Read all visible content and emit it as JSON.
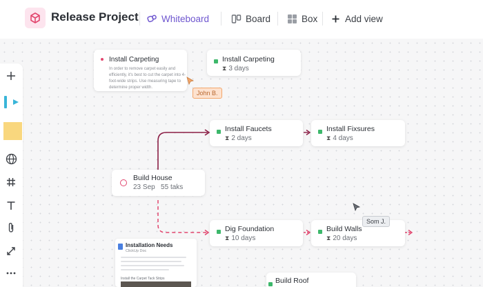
{
  "header": {
    "project_title": "Release Project",
    "tabs": [
      {
        "label": "Whiteboard",
        "icon": "whiteboard-icon",
        "active": true
      },
      {
        "label": "Board",
        "icon": "board-icon",
        "active": false
      },
      {
        "label": "Box",
        "icon": "box-icon",
        "active": false
      }
    ],
    "add_view_label": "Add view"
  },
  "toolbar": {
    "tools": [
      "plus-icon",
      "pen-icon",
      "sticky-note-icon",
      "globe-icon",
      "hash-icon",
      "text-icon",
      "attachment-icon",
      "connector-icon",
      "more-icon"
    ]
  },
  "note": {
    "title": "Install Carpeting",
    "body": "In order to remove carpet easily and efficiently, it's best to cut the carpet into 4-foot-wide strips. Use measuring tape to determine proper width."
  },
  "tasks": {
    "install_carpeting": {
      "name": "Install Carpeting",
      "duration": "3 days"
    },
    "install_faucets": {
      "name": "Install Faucets",
      "duration": "2 days"
    },
    "install_fixtures": {
      "name": "Install Fixsures",
      "duration": "4 days"
    },
    "dig_foundation": {
      "name": "Dig Foundation",
      "duration": "10 days"
    },
    "build_walls": {
      "name": "Build Walls",
      "duration": "20 days"
    },
    "build_roof": {
      "name": "Build Roof"
    }
  },
  "build_house": {
    "name": "Build House",
    "date": "23 Sep",
    "tasks": "55 taks"
  },
  "cursors": {
    "john": "John B.",
    "som": "Som J."
  },
  "doc": {
    "title": "Installation Needs",
    "subtitle": "ClickUp Doc",
    "item": "Install the Carpet Tack Strips"
  },
  "colors": {
    "accent": "#6e56cf",
    "task_dot": "#3db86b",
    "edge_solid": "#8b1e45",
    "edge_dashed": "#e2466e",
    "john_cursor": "#f3a66b"
  }
}
